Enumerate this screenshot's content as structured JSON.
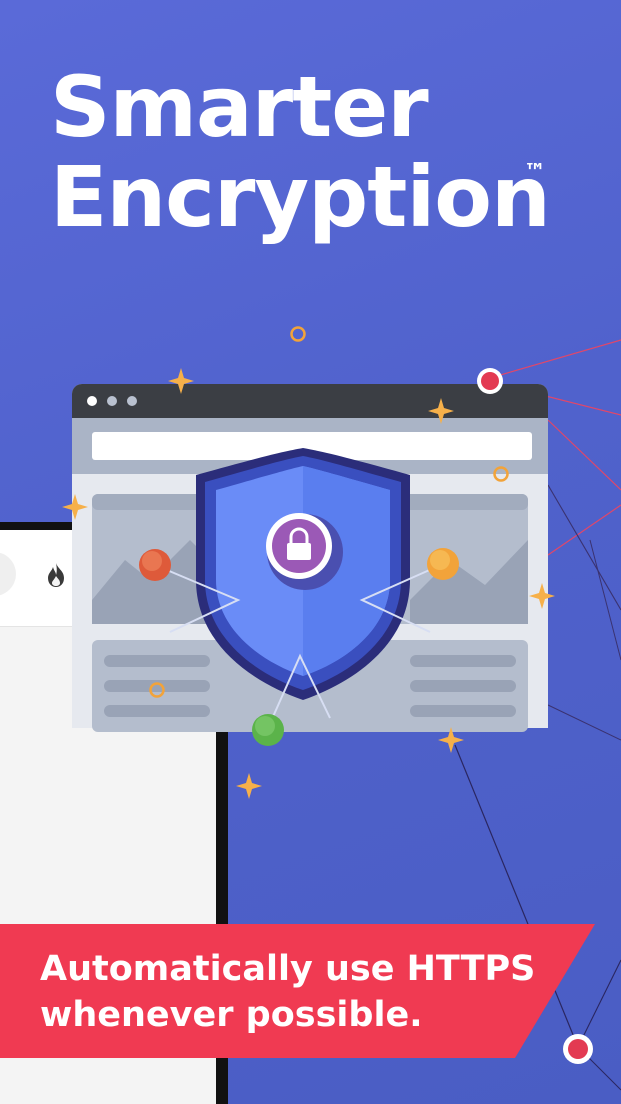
{
  "headline": {
    "line1": "Smarter",
    "line2": "Encryption",
    "trademark": "™"
  },
  "banner": {
    "line1": "Automatically use HTTPS",
    "line2": "whenever possible."
  },
  "illustration": {
    "main_icon": "shield-lock-icon",
    "window_icon": "browser-window-icon",
    "phone_icon": "flame-icon"
  },
  "colors": {
    "background": "#5062cc",
    "banner": "#f03a52",
    "shield": "#5b86f5",
    "shield_border": "#2f3fa8",
    "lock_circle": "#9b59b6",
    "node_red": "#de5a3a",
    "node_orange": "#f2a33a",
    "node_green": "#5bb34a",
    "sparkle": "#f6b04a"
  }
}
